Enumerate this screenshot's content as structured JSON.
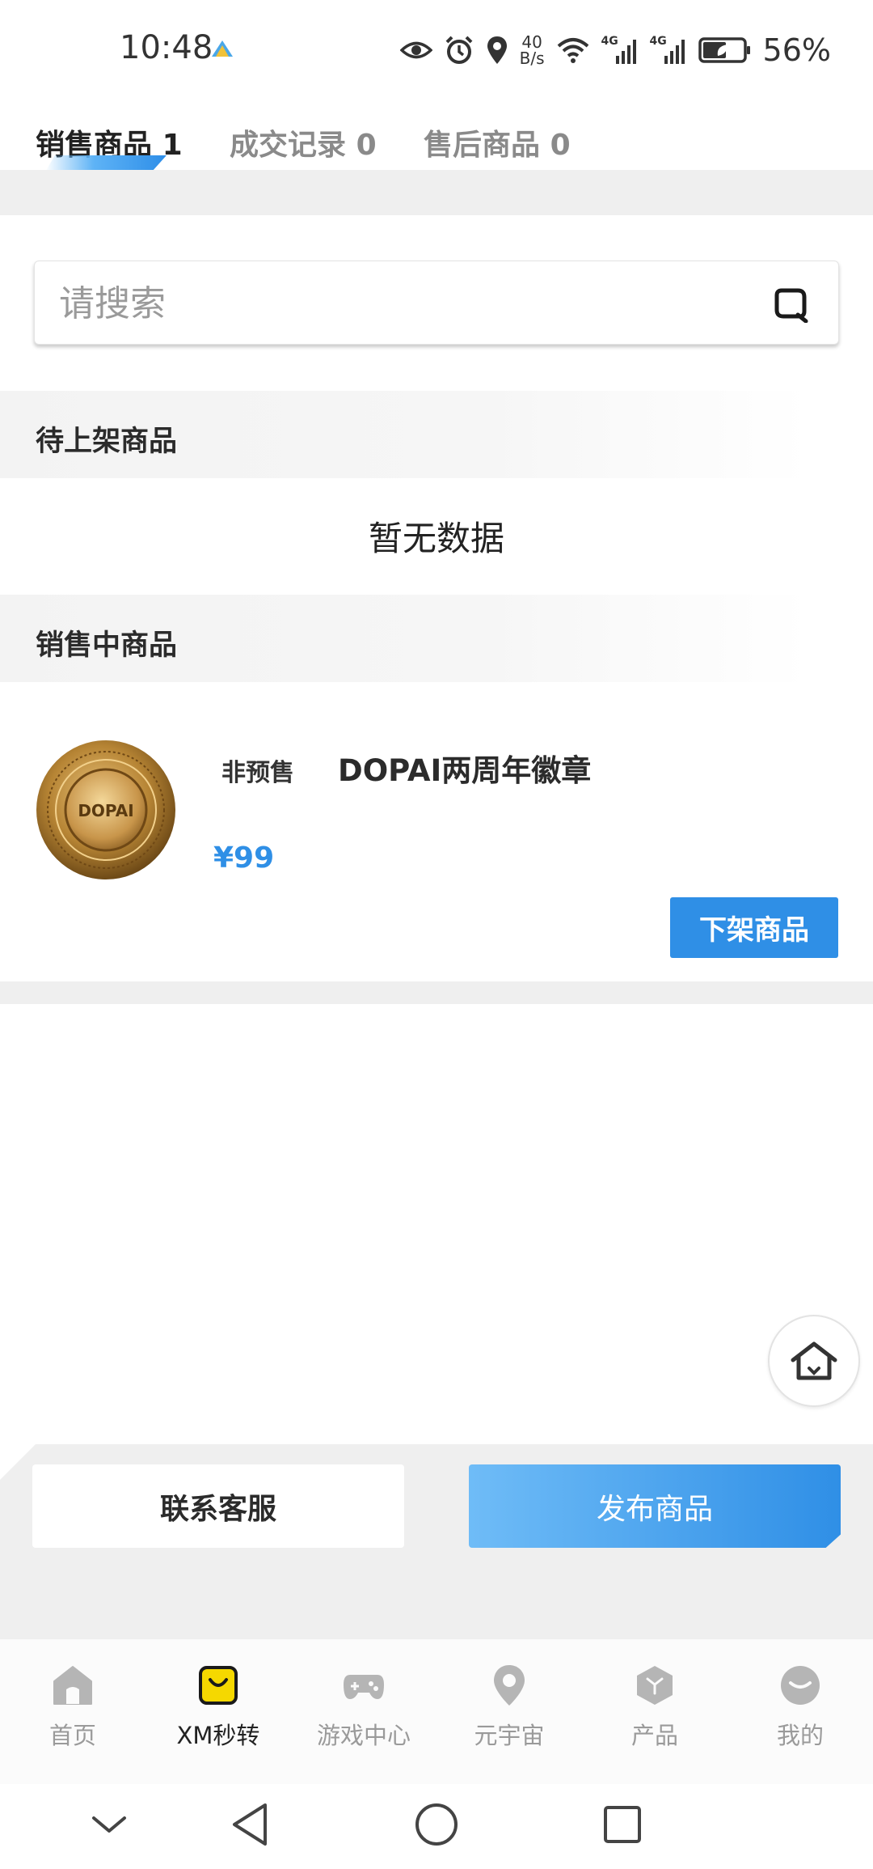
{
  "status_bar": {
    "time": "10:48",
    "net_speed_value": "40",
    "net_speed_unit": "B/s",
    "signal1_label": "4G",
    "signal2_label": "4G",
    "battery": "56%"
  },
  "tabs": [
    {
      "label": "销售商品",
      "count": "1"
    },
    {
      "label": "成交记录",
      "count": "0"
    },
    {
      "label": "售后商品",
      "count": "0"
    }
  ],
  "search": {
    "placeholder": "请搜索"
  },
  "sections": {
    "pending_title": "待上架商品",
    "pending_empty": "暂无数据",
    "selling_title": "销售中商品"
  },
  "product": {
    "presale_tag": "非预售",
    "name": "DOPAI两周年徽章",
    "price": "¥99",
    "image_text": "DOPAI",
    "delist_label": "下架商品"
  },
  "actions": {
    "contact_label": "联系客服",
    "publish_label": "发布商品"
  },
  "nav": [
    {
      "label": "首页",
      "icon": "home-icon"
    },
    {
      "label": "XM秒转",
      "icon": "shopping-bag-icon"
    },
    {
      "label": "游戏中心",
      "icon": "gamepad-icon"
    },
    {
      "label": "元宇宙",
      "icon": "location-pin-icon"
    },
    {
      "label": "产品",
      "icon": "cube-icon"
    },
    {
      "label": "我的",
      "icon": "profile-icon"
    }
  ],
  "colors": {
    "accent": "#2f8fe6",
    "accent_light": "#6fbcf7",
    "nav_active": "#f5d800",
    "nav_inactive": "#b0b0b0"
  }
}
